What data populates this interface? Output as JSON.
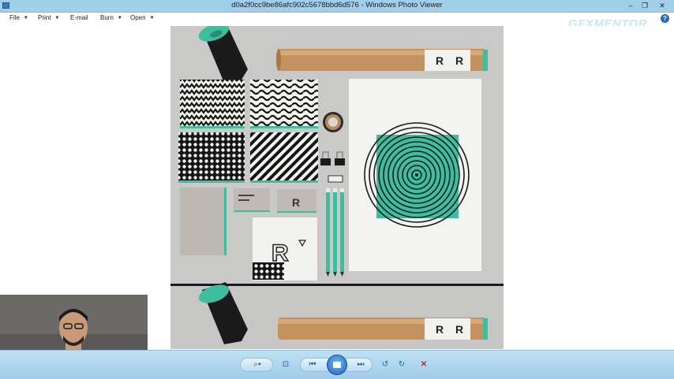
{
  "window": {
    "title": "d0a2f0cc9be86afc902c5678bbd6d576 - Windows Photo Viewer",
    "minimize_glyph": "–",
    "restore_glyph": "❐",
    "close_glyph": "✕"
  },
  "menu": {
    "items": [
      {
        "label": "File",
        "has_arrow": true
      },
      {
        "label": "Print",
        "has_arrow": true
      },
      {
        "label": "E-mail",
        "has_arrow": false
      },
      {
        "label": "Burn",
        "has_arrow": true
      },
      {
        "label": "Open",
        "has_arrow": true
      }
    ],
    "arrow_glyph": "▼",
    "help_glyph": "?"
  },
  "watermark": {
    "text": "GFXMENTOR"
  },
  "toolbar": {
    "zoom_glyph": "⌕",
    "zoom_arrow": "▾",
    "actual_size_glyph": "⊡",
    "previous_glyph": "⏮",
    "next_glyph": "⏭",
    "rotate_ccw_glyph": "↺",
    "rotate_cw_glyph": "↻",
    "delete_glyph": "✕"
  },
  "colors": {
    "titlebar": "#9fcfea",
    "toolbar": "#a7d3ec",
    "accent_teal": "#3dbf9f",
    "delete_red": "#d22222"
  },
  "photo": {
    "logo_letter": "R",
    "pattern_cards": 4,
    "pencils": 3
  }
}
